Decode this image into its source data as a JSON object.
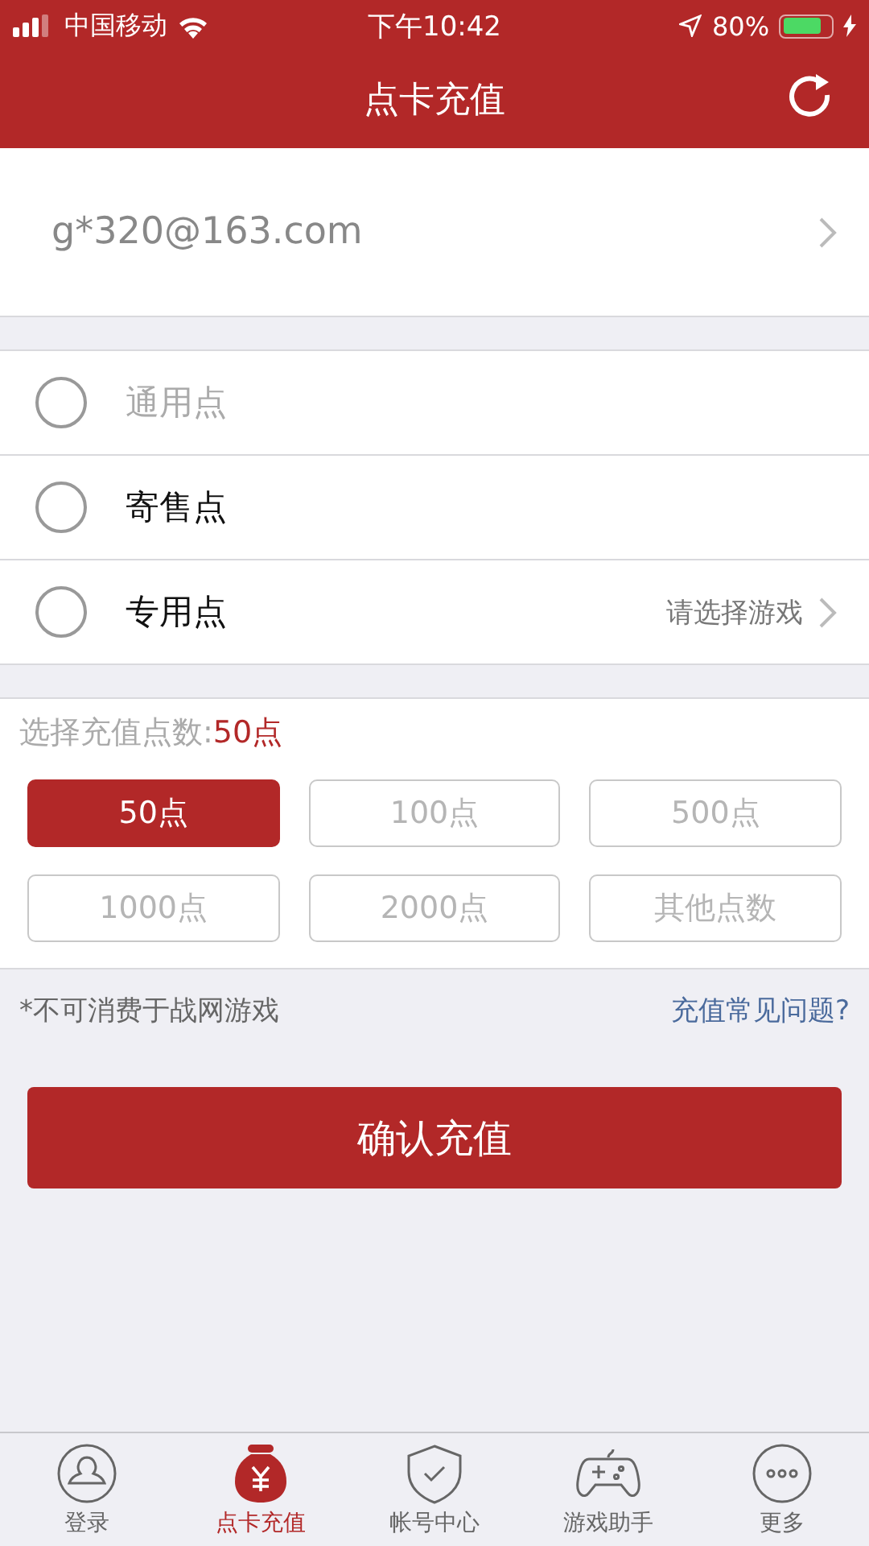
{
  "status_bar": {
    "carrier": "中国移动",
    "time": "下午10:42",
    "battery_text": "80%"
  },
  "nav": {
    "title": "点卡充值"
  },
  "account": {
    "value": "g*320@163.com"
  },
  "point_types": [
    {
      "label": "通用点",
      "selected": false,
      "disabled": true
    },
    {
      "label": "寄售点",
      "selected": false,
      "disabled": false
    },
    {
      "label": "专用点",
      "selected": false,
      "disabled": false,
      "hint": "请选择游戏"
    }
  ],
  "amount": {
    "label": "选择充值点数:",
    "value": "50点"
  },
  "options": [
    {
      "label": "50点",
      "selected": true
    },
    {
      "label": "100点",
      "selected": false
    },
    {
      "label": "500点",
      "selected": false
    },
    {
      "label": "1000点",
      "selected": false
    },
    {
      "label": "2000点",
      "selected": false
    },
    {
      "label": "其他点数",
      "selected": false
    }
  ],
  "note": "*不可消费于战网游戏",
  "faq_link": "充值常见问题?",
  "confirm_button": "确认充值",
  "tabs": [
    {
      "label": "登录",
      "selected": false
    },
    {
      "label": "点卡充值",
      "selected": true
    },
    {
      "label": "帐号中心",
      "selected": false
    },
    {
      "label": "游戏助手",
      "selected": false
    },
    {
      "label": "更多",
      "selected": false
    }
  ]
}
